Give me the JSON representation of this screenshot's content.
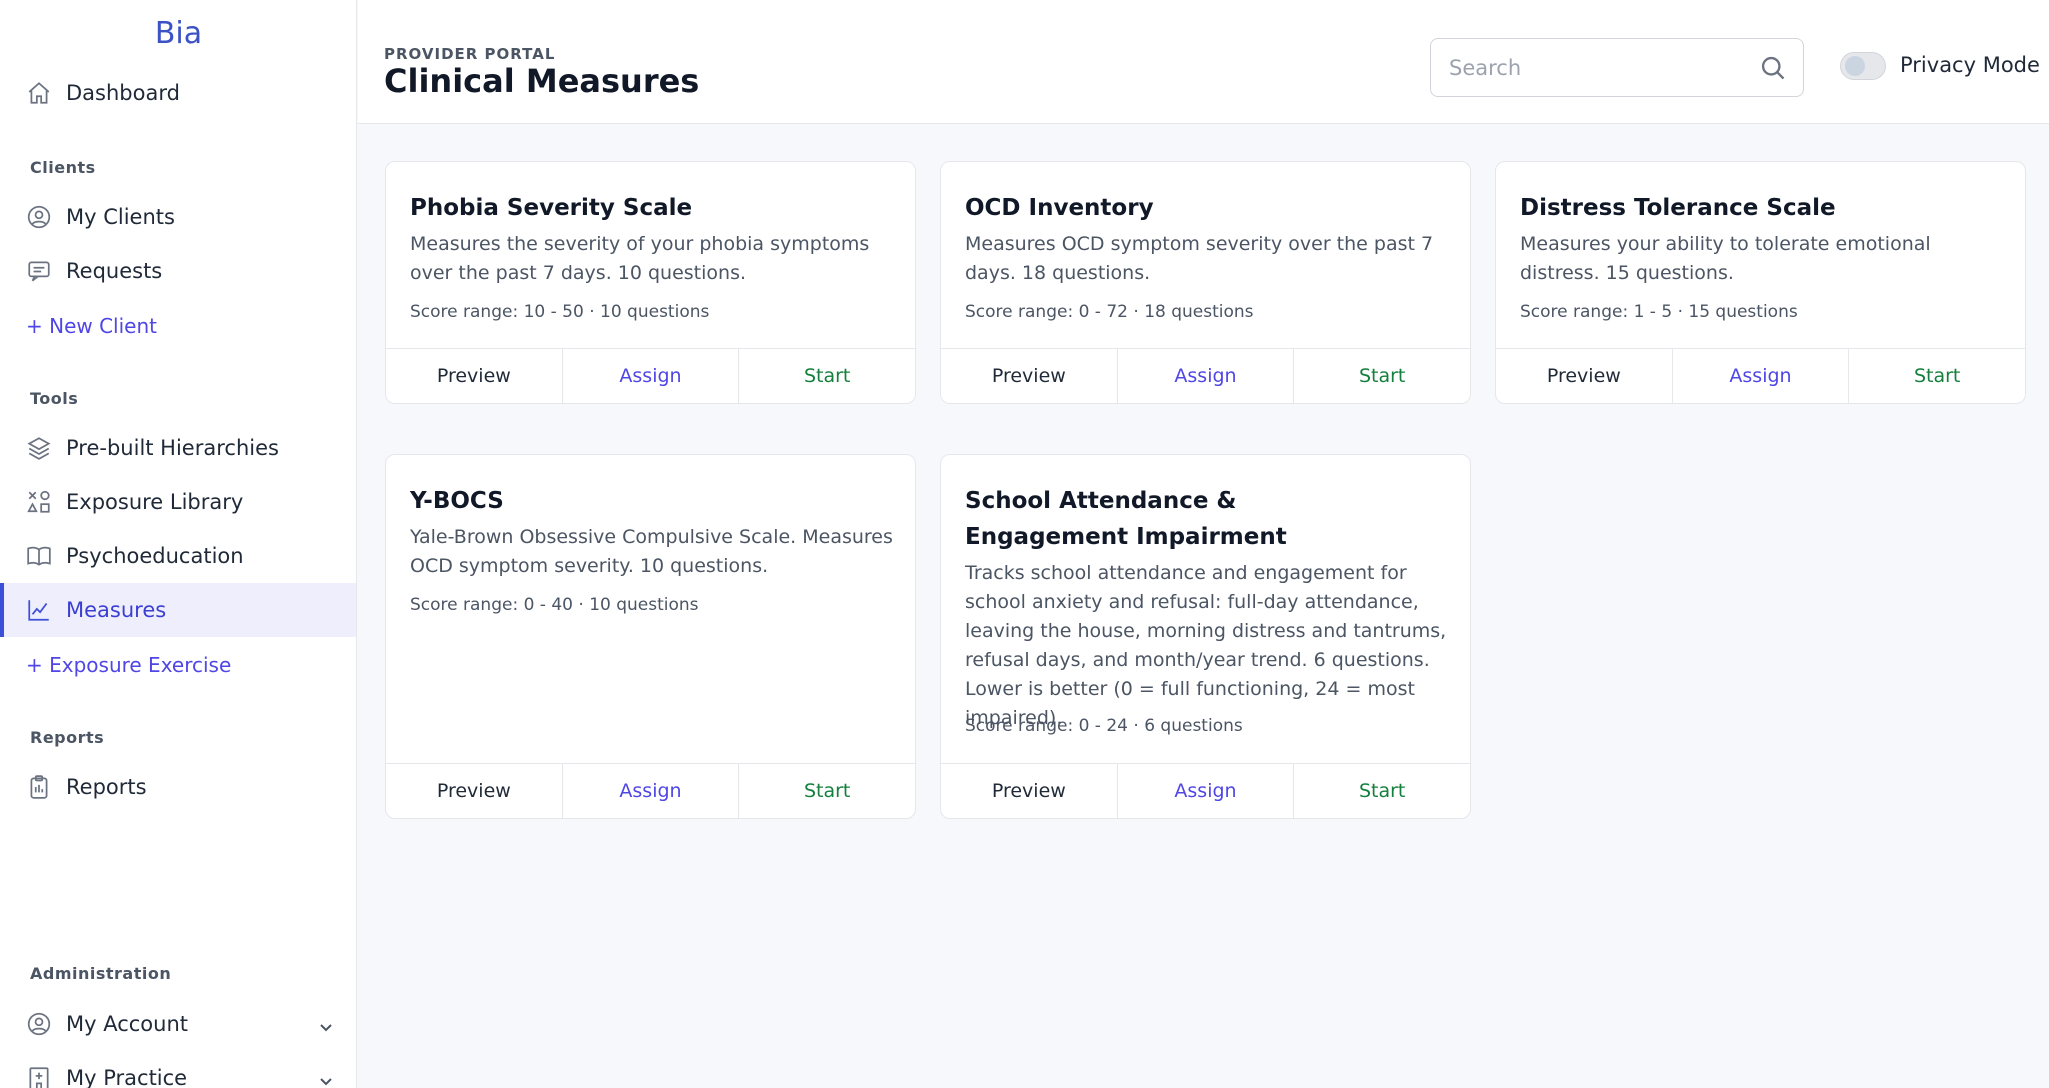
{
  "app": {
    "brand": "Bia"
  },
  "sidebar": {
    "dashboard": "Dashboard",
    "sections": {
      "clients": "Clients",
      "tools": "Tools",
      "reports": "Reports",
      "administration": "Administration"
    },
    "my_clients": "My Clients",
    "requests": "Requests",
    "new_client": "+ New Client",
    "prebuilt_hierarchies": "Pre-built Hierarchies",
    "exposure_library": "Exposure Library",
    "psychoeducation": "Psychoeducation",
    "measures": "Measures",
    "exposure_exercise": "+ Exposure Exercise",
    "reports": "Reports",
    "my_account": "My Account",
    "my_practice": "My Practice",
    "active_item": "Measures"
  },
  "header": {
    "eyebrow": "PROVIDER PORTAL",
    "title": "Clinical Measures",
    "search_placeholder": "Search",
    "search_value": "",
    "privacy_mode_label": "Privacy Mode",
    "privacy_mode_on": false
  },
  "actions": {
    "preview": "Preview",
    "assign": "Assign",
    "start": "Start"
  },
  "measures": [
    {
      "title": "Phobia Severity Scale",
      "description": "Measures the severity of your phobia symptoms over the past 7 days. 10 questions.",
      "score_range": "Score range: 10 - 50",
      "questions": "10 questions"
    },
    {
      "title": "OCD Inventory",
      "description": "Measures OCD symptom severity over the past 7 days. 18 questions.",
      "score_range": "Score range: 0 - 72",
      "questions": "18 questions"
    },
    {
      "title": "Distress Tolerance Scale",
      "description": "Measures your ability to tolerate emotional distress. 15 questions.",
      "score_range": "Score range: 1 - 5",
      "questions": "15 questions"
    },
    {
      "title": "Y-BOCS",
      "description": "Yale-Brown Obsessive Compulsive Scale. Measures OCD symptom severity. 10 questions.",
      "score_range": "Score range: 0 - 40",
      "questions": "10 questions"
    },
    {
      "title": "School Attendance & Engagement Impairment",
      "description": "Tracks school attendance and engagement for school anxiety and refusal: full-day attendance, leaving the house, morning distress and tantrums, refusal days, and month/year trend. 6 questions. Lower is better (0 = full functioning, 24 = most impaired).",
      "score_range": "Score range: 0 - 24",
      "questions": "6 questions"
    }
  ],
  "meta_separator": "·",
  "colors": {
    "accent": "#4f46e5",
    "start": "#15803d",
    "brand": "#3b52c4"
  }
}
